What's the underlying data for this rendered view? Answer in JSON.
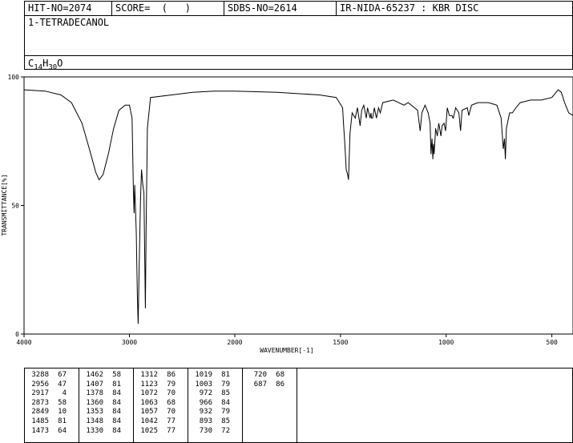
{
  "header": {
    "hit_no": "HIT-NO=2074",
    "score": "SCORE=  (   )",
    "sdbs_no": "SDBS-NO=2614",
    "ir_method": "IR-NIDA-65237 : KBR DISC",
    "compound_name": "1-TETRADECANOL",
    "formula": {
      "c": "C",
      "c_count": "14",
      "h": "H",
      "h_count": "30",
      "o": "O"
    }
  },
  "chart_data": {
    "type": "line",
    "xlabel": "WAVENUMBER[-1]",
    "ylabel": "TRANSMITTANCE[%]",
    "xlim": [
      4000,
      400
    ],
    "ylim": [
      0,
      100
    ],
    "x_ticks": [
      4000,
      3000,
      2000,
      1500,
      1000,
      500
    ],
    "y_ticks": [
      0,
      50,
      100
    ],
    "spectrum": [
      [
        4000,
        95
      ],
      [
        3800,
        94.5
      ],
      [
        3650,
        93
      ],
      [
        3550,
        90
      ],
      [
        3450,
        82
      ],
      [
        3380,
        72
      ],
      [
        3320,
        63
      ],
      [
        3288,
        60
      ],
      [
        3250,
        62
      ],
      [
        3200,
        70
      ],
      [
        3150,
        80
      ],
      [
        3100,
        87
      ],
      [
        3040,
        89
      ],
      [
        3000,
        89
      ],
      [
        2975,
        84
      ],
      [
        2962,
        55
      ],
      [
        2956,
        47
      ],
      [
        2950,
        58
      ],
      [
        2935,
        40
      ],
      [
        2925,
        15
      ],
      [
        2917,
        4
      ],
      [
        2910,
        20
      ],
      [
        2895,
        52
      ],
      [
        2885,
        64
      ],
      [
        2873,
        58
      ],
      [
        2862,
        55
      ],
      [
        2855,
        30
      ],
      [
        2849,
        10
      ],
      [
        2842,
        40
      ],
      [
        2830,
        80
      ],
      [
        2800,
        92
      ],
      [
        2600,
        93
      ],
      [
        2400,
        94
      ],
      [
        2200,
        94.5
      ],
      [
        2000,
        94.5
      ],
      [
        1800,
        94
      ],
      [
        1600,
        93
      ],
      [
        1520,
        92
      ],
      [
        1490,
        88
      ],
      [
        1485,
        81
      ],
      [
        1480,
        75
      ],
      [
        1473,
        64
      ],
      [
        1466,
        62
      ],
      [
        1462,
        60
      ],
      [
        1455,
        78
      ],
      [
        1445,
        86
      ],
      [
        1430,
        84
      ],
      [
        1420,
        88
      ],
      [
        1407,
        81
      ],
      [
        1400,
        87
      ],
      [
        1390,
        89
      ],
      [
        1378,
        84
      ],
      [
        1372,
        88
      ],
      [
        1360,
        84
      ],
      [
        1356,
        86
      ],
      [
        1353,
        84
      ],
      [
        1348,
        84
      ],
      [
        1340,
        88
      ],
      [
        1330,
        84
      ],
      [
        1320,
        88
      ],
      [
        1312,
        86
      ],
      [
        1300,
        90
      ],
      [
        1250,
        91
      ],
      [
        1200,
        89
      ],
      [
        1180,
        90
      ],
      [
        1150,
        88
      ],
      [
        1135,
        87
      ],
      [
        1123,
        79
      ],
      [
        1115,
        86
      ],
      [
        1100,
        89
      ],
      [
        1085,
        86
      ],
      [
        1076,
        82
      ],
      [
        1072,
        70
      ],
      [
        1067,
        76
      ],
      [
        1063,
        68
      ],
      [
        1060,
        74
      ],
      [
        1057,
        70
      ],
      [
        1050,
        80
      ],
      [
        1042,
        77
      ],
      [
        1035,
        82
      ],
      [
        1025,
        77
      ],
      [
        1019,
        81
      ],
      [
        1010,
        82
      ],
      [
        1003,
        79
      ],
      [
        995,
        88
      ],
      [
        985,
        85
      ],
      [
        972,
        85
      ],
      [
        968,
        84
      ],
      [
        966,
        84
      ],
      [
        955,
        88
      ],
      [
        940,
        86
      ],
      [
        932,
        79
      ],
      [
        925,
        87
      ],
      [
        900,
        88
      ],
      [
        893,
        85
      ],
      [
        880,
        89
      ],
      [
        850,
        90
      ],
      [
        800,
        90
      ],
      [
        760,
        89
      ],
      [
        740,
        84
      ],
      [
        730,
        72
      ],
      [
        724,
        76
      ],
      [
        720,
        68
      ],
      [
        715,
        80
      ],
      [
        700,
        86
      ],
      [
        687,
        86
      ],
      [
        670,
        88
      ],
      [
        650,
        90
      ],
      [
        600,
        91
      ],
      [
        550,
        91
      ],
      [
        500,
        92
      ],
      [
        470,
        95
      ],
      [
        455,
        94
      ],
      [
        440,
        90
      ],
      [
        420,
        86
      ],
      [
        400,
        85
      ]
    ]
  },
  "peaks": [
    {
      "wavenumber": "3288",
      "transmittance": "67"
    },
    {
      "wavenumber": "2956",
      "transmittance": "47"
    },
    {
      "wavenumber": "2917",
      "transmittance": "4"
    },
    {
      "wavenumber": "2873",
      "transmittance": "58"
    },
    {
      "wavenumber": "2849",
      "transmittance": "10"
    },
    {
      "wavenumber": "1485",
      "transmittance": "81"
    },
    {
      "wavenumber": "1473",
      "transmittance": "64"
    },
    {
      "wavenumber": "1462",
      "transmittance": "58"
    },
    {
      "wavenumber": "1407",
      "transmittance": "81"
    },
    {
      "wavenumber": "1378",
      "transmittance": "84"
    },
    {
      "wavenumber": "1360",
      "transmittance": "84"
    },
    {
      "wavenumber": "1353",
      "transmittance": "84"
    },
    {
      "wavenumber": "1348",
      "transmittance": "84"
    },
    {
      "wavenumber": "1330",
      "transmittance": "84"
    },
    {
      "wavenumber": "1312",
      "transmittance": "86"
    },
    {
      "wavenumber": "1123",
      "transmittance": "79"
    },
    {
      "wavenumber": "1072",
      "transmittance": "70"
    },
    {
      "wavenumber": "1063",
      "transmittance": "68"
    },
    {
      "wavenumber": "1057",
      "transmittance": "70"
    },
    {
      "wavenumber": "1042",
      "transmittance": "77"
    },
    {
      "wavenumber": "1025",
      "transmittance": "77"
    },
    {
      "wavenumber": "1019",
      "transmittance": "81"
    },
    {
      "wavenumber": "1003",
      "transmittance": "79"
    },
    {
      "wavenumber": "972",
      "transmittance": "85"
    },
    {
      "wavenumber": "966",
      "transmittance": "84"
    },
    {
      "wavenumber": "932",
      "transmittance": "79"
    },
    {
      "wavenumber": "893",
      "transmittance": "85"
    },
    {
      "wavenumber": "730",
      "transmittance": "72"
    },
    {
      "wavenumber": "720",
      "transmittance": "68"
    },
    {
      "wavenumber": "687",
      "transmittance": "86"
    }
  ]
}
